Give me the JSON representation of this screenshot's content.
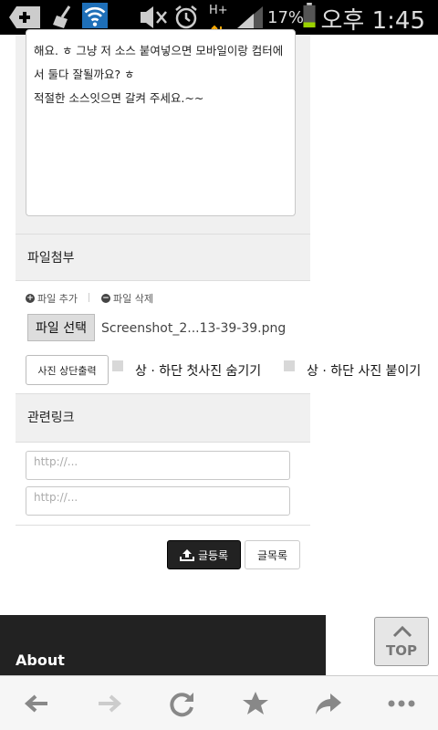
{
  "status_bar": {
    "signal_label": "H+",
    "battery_percent": "17%",
    "time": "오후 1:45"
  },
  "editor": {
    "lines": [
      "해요. ㅎ 그냥 저 소스 붙여넣으면 모바일이랑 컴터에",
      "서 둘다 잘될까요? ㅎ",
      "적절한 소스잇으면 갈켜 주세요.~~"
    ]
  },
  "attachment": {
    "section_title": "파일첨부",
    "add_file_label": "파일 추가",
    "delete_file_label": "파일 삭제",
    "choose_file_label": "파일 선택",
    "file_name": "Screenshot_2...13-39-39.png"
  },
  "photo_options": {
    "top_print_label": "사진 상단출력",
    "hide_first_label": "상 · 하단 첫사진 숨기기",
    "attach_label": "상 · 하단 사진 붙이기"
  },
  "links": {
    "section_title": "관련링크",
    "placeholder_1": "http://...",
    "placeholder_2": "http://..."
  },
  "actions": {
    "submit_label": "글등록",
    "list_label": "글목록"
  },
  "footer": {
    "about_label": "About",
    "top_label": "TOP"
  },
  "nav": {
    "icons": [
      "back-icon",
      "forward-icon",
      "reload-icon",
      "bookmark-star-icon",
      "share-icon",
      "more-icon"
    ]
  }
}
